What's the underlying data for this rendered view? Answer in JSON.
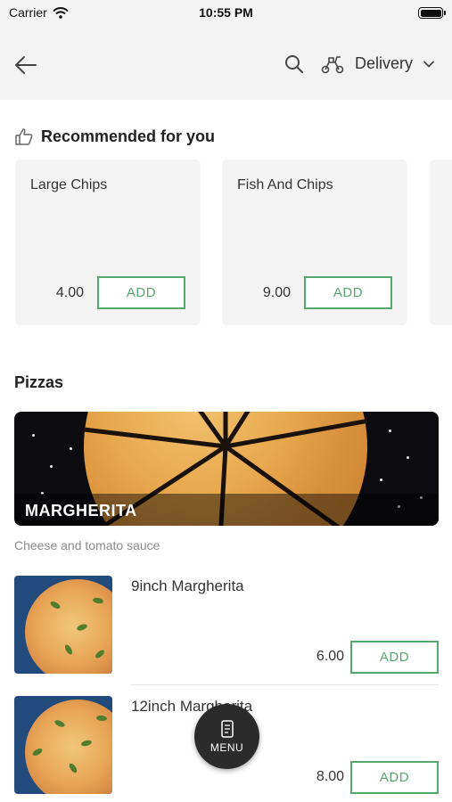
{
  "status_bar": {
    "carrier": "Carrier",
    "time": "10:55 PM"
  },
  "nav": {
    "delivery_label": "Delivery",
    "icons": [
      "back-arrow-icon",
      "search-icon",
      "scooter-icon",
      "chevron-down-icon"
    ]
  },
  "recommended": {
    "title": "Recommended for you",
    "items": [
      {
        "name": "Large Chips",
        "price": "4.00",
        "add_label": "ADD"
      },
      {
        "name": "Fish And Chips",
        "price": "9.00",
        "add_label": "ADD"
      }
    ]
  },
  "section": {
    "title": "Pizzas",
    "banner_label": "MARGHERITA",
    "banner_description": "Cheese and tomato sauce",
    "items": [
      {
        "name": "9inch Margherita",
        "price": "6.00",
        "add_label": "ADD"
      },
      {
        "name": "12inch Margherita",
        "price": "8.00",
        "add_label": "ADD"
      }
    ]
  },
  "fab": {
    "label": "MENU"
  },
  "colors": {
    "accent": "#55a86b",
    "header_bg": "#f3f3f3",
    "card_bg": "#f4f4f4",
    "fab_bg": "#2b2b2b"
  }
}
